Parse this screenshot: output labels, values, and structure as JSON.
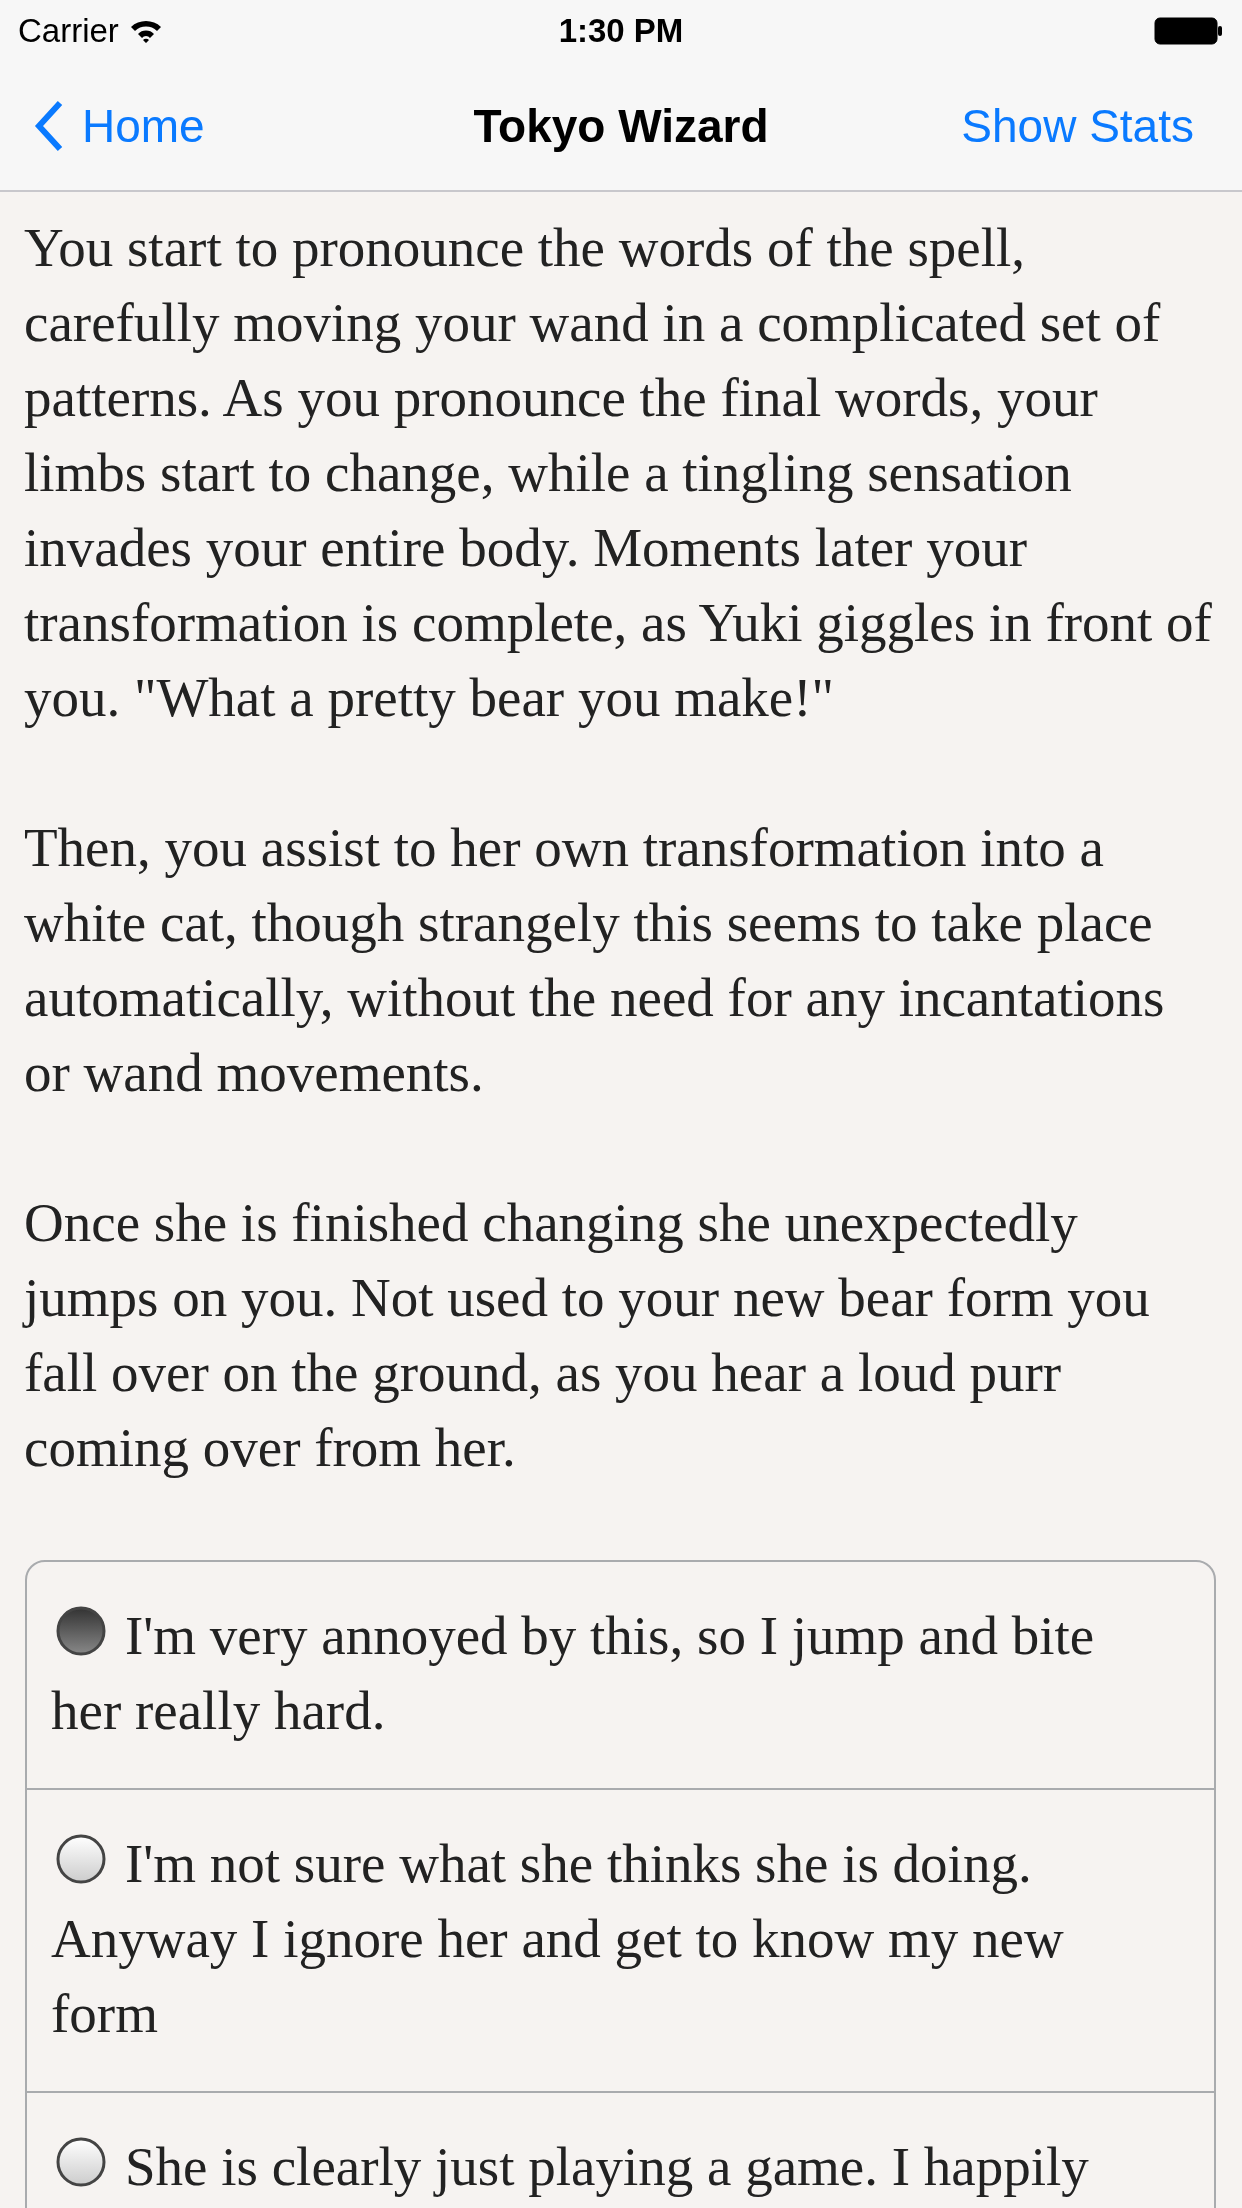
{
  "status_bar": {
    "carrier": "Carrier",
    "time": "1:30 PM"
  },
  "nav_bar": {
    "back": "Home",
    "title": "Tokyo Wizard",
    "action": "Show Stats"
  },
  "story": [
    "You start to pronounce the words of the spell, carefully moving your wand in a complicated set of patterns. As you pronounce the final words, your limbs start to change, while a tingling sensation invades your entire body. Moments later your transformation is complete, as Yuki giggles in front of you. \"What a pretty bear you make!\"",
    "Then, you assist to her own transformation into a white cat, though strangely this seems to take place automatically, without the need for any incantations or wand movements.",
    "Once she is finished changing she unexpectedly jumps on you. Not used to your new bear form you fall over on the ground, as you hear a loud purr coming over from her."
  ],
  "choices": [
    {
      "label": "I'm very annoyed by this, so I jump and bite her really hard.",
      "selected": true
    },
    {
      "label": "I'm not sure what she thinks she is doing. Anyway I ignore her and get to know my new form",
      "selected": false
    },
    {
      "label": "She is clearly just playing a game. I happily",
      "selected": false
    }
  ]
}
